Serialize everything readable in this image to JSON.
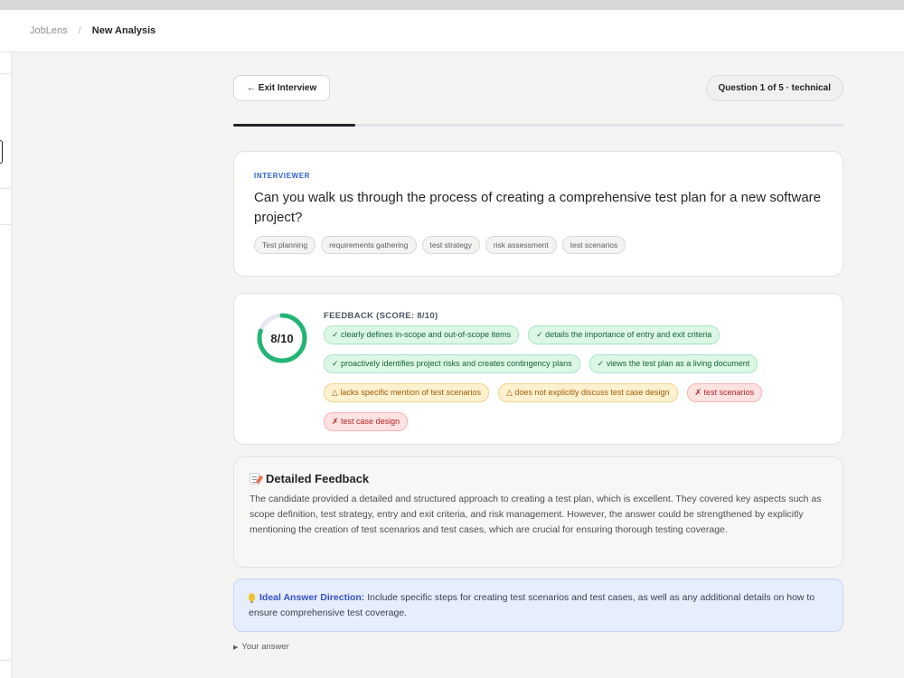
{
  "breadcrumb": {
    "root": "JobLens",
    "separator": "/",
    "current": "New Analysis"
  },
  "toolbar": {
    "exit_label": "← Exit Interview",
    "question_counter": "Question 1 of 5 · technical"
  },
  "progress": {
    "current": 1,
    "total": 5,
    "fraction": 0.2
  },
  "question": {
    "role_label": "INTERVIEWER",
    "text": "Can you walk us through the process of creating a comprehensive test plan for a new software project?",
    "tags": [
      "Test planning",
      "requirements gathering",
      "test strategy",
      "risk assessment",
      "test scenarios"
    ]
  },
  "feedback": {
    "score": 8,
    "max_score": 10,
    "score_label": "8/10",
    "title": "FEEDBACK (SCORE: 8/10)",
    "pills": [
      {
        "kind": "pos",
        "text": "✓ clearly defines in-scope and out-of-scope items"
      },
      {
        "kind": "pos",
        "text": "✓ details the importance of entry and exit criteria"
      },
      {
        "kind": "pos",
        "text": "✓ proactively identifies project risks and creates contingency plans"
      },
      {
        "kind": "pos",
        "text": "✓ views the test plan as a living document"
      },
      {
        "kind": "warn",
        "text": "△ lacks specific mention of test scenarios"
      },
      {
        "kind": "warn",
        "text": "△ does not explicitly discuss test case design"
      },
      {
        "kind": "neg",
        "text": "✗ test scenarios"
      },
      {
        "kind": "neg",
        "text": "✗ test case design"
      }
    ],
    "colors": {
      "ring_fill": "#22b573",
      "ring_track": "#e3e7ee"
    }
  },
  "detailed": {
    "title": "Detailed Feedback",
    "body": "The candidate provided a detailed and structured approach to creating a test plan, which is excellent. They covered key aspects such as scope definition, test strategy, entry and exit criteria, and risk management. However, the answer could be strengthened by explicitly mentioning the creation of test scenarios and test cases, which are crucial for ensuring thorough testing coverage."
  },
  "ideal": {
    "label": "Ideal Answer Direction:",
    "text": " Include specific steps for creating test scenarios and test cases, as well as any additional details on how to ensure comprehensive test coverage."
  },
  "your_answer": {
    "label": "Your answer"
  }
}
